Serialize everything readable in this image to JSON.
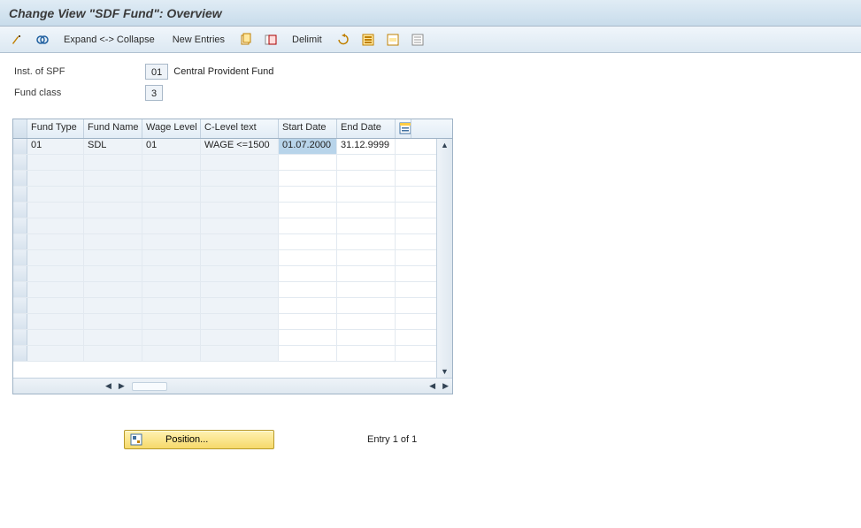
{
  "title": "Change View \"SDF Fund\": Overview",
  "toolbar": {
    "expand_collapse": "Expand <-> Collapse",
    "new_entries": "New Entries",
    "delimit": "Delimit"
  },
  "form": {
    "inst_label": "Inst. of SPF",
    "inst_value": "01",
    "inst_desc": "Central Provident Fund",
    "fund_class_label": "Fund class",
    "fund_class_value": "3"
  },
  "table": {
    "headers": {
      "fund_type": "Fund Type",
      "fund_name": "Fund Name",
      "wage_level": "Wage Level",
      "c_level_text": "C-Level text",
      "start_date": "Start Date",
      "end_date": "End Date"
    },
    "rows": [
      {
        "fund_type": "01",
        "fund_name": "SDL",
        "wage_level": "01",
        "c_level_text": "WAGE <=1500",
        "start_date": "01.07.2000",
        "end_date": "31.12.9999"
      }
    ]
  },
  "footer": {
    "position_label": "Position...",
    "entry_text": "Entry 1 of 1"
  }
}
